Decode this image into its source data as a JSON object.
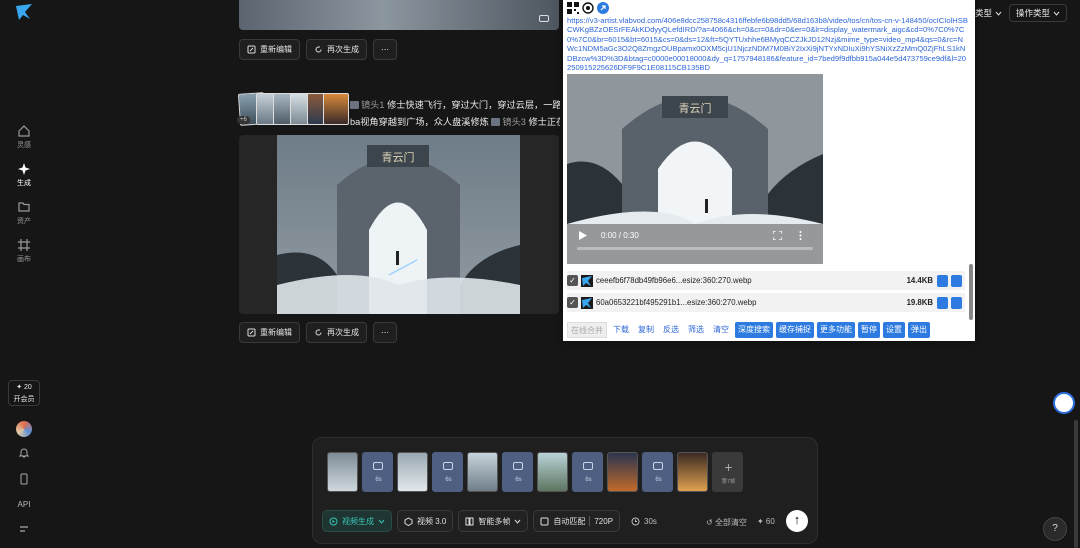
{
  "rail": {
    "items": [
      {
        "label": "灵感",
        "icon": "home-icon"
      },
      {
        "label": "生成",
        "icon": "sparkle-icon"
      },
      {
        "label": "资产",
        "icon": "folder-icon"
      },
      {
        "label": "画布",
        "icon": "canvas-icon"
      }
    ],
    "vip": {
      "top": "✦ 20",
      "label": "开会员"
    },
    "api_label": "API"
  },
  "feed": {
    "actions": {
      "reedit": "重新编辑",
      "regenerate": "再次生成",
      "more": "⋯"
    },
    "thumb_count": "+6",
    "prompt": {
      "cam1": "镜头1",
      "line1": "修士快速飞行，穿过大门，穿过云层，一路向",
      "line2": "ba视角穿越到广场，众人盘溪修炼",
      "cam3": "镜头3",
      "line2b": "修士正在"
    },
    "video_sign": "青云门"
  },
  "popup": {
    "url": "https://v3-artist.vlabvod.com/406e8dcc258758c4316ffebfe6b98dd5/68d163b8/video/tos/cn/tos-cn-v-148450/ocICIolHSBCWKgBZzOESrFEAkKDdyyQLefdIRD/?a=4066&ch=0&cr=0&dr=0&er=0&lr=display_watermark_aigc&cd=0%7C0%7C0%7C0&br=6015&bt=6015&cs=0&ds=12&ft=5QYTUxhhe6BMyqCCZJkJD12Nzj&mime_type=video_mp4&qs=0&rc=NWc1NDM5aGc3O2Q8ZmgzOUBpamx0OXM5cjU1NjczNDM7M0BiY2IxXi9jNTYxNDIuXi9hYSNiXzZzMmQ0ZjFhLS1kNDBzcw%3D%3D&btag=c0000e00018000&dy_q=1757948186&feature_id=7bed9f9dfbb915a044e5d473759ce9df&l=20250915225626DF9F9C1E08115CB135BD",
    "video_time": "0:00 / 0:30",
    "files": [
      {
        "name": "ceeefb6f78db49fb96e6...esize:360:270.webp",
        "size": "14.4KB"
      },
      {
        "name": "60a0653221bf495291b1...esize:360:270.webp",
        "size": "19.8KB"
      }
    ],
    "toolbar": [
      {
        "label": "在线合并",
        "style": "disabled"
      },
      {
        "label": "下载",
        "style": "link"
      },
      {
        "label": "复制",
        "style": "link"
      },
      {
        "label": "反选",
        "style": "link"
      },
      {
        "label": "筛选",
        "style": "link"
      },
      {
        "label": "清空",
        "style": "link"
      },
      {
        "label": "深度搜索",
        "style": "prim"
      },
      {
        "label": "缓存捕捉",
        "style": "prim"
      },
      {
        "label": "更多功能",
        "style": "prim"
      },
      {
        "label": "暂停",
        "style": "prim"
      },
      {
        "label": "设置",
        "style": "prim"
      },
      {
        "label": "弹出",
        "style": "prim"
      }
    ]
  },
  "top_right": {
    "type_filter": "类型",
    "op_filter": "操作类型"
  },
  "composer": {
    "gap_label": "6s",
    "add_label": "第7帧",
    "mode": "视频生成",
    "model": "视频 3.0",
    "multiframe": "智能多帧",
    "ratio": "自动匹配",
    "resolution": "720P",
    "duration": "30s",
    "clear": "全部清空",
    "cost": "✦ 60",
    "send": "↑"
  },
  "help": "?",
  "colors": {
    "accent": "#38c4b4",
    "link": "#2d67d8",
    "primary_btn": "#2d7ae0"
  }
}
